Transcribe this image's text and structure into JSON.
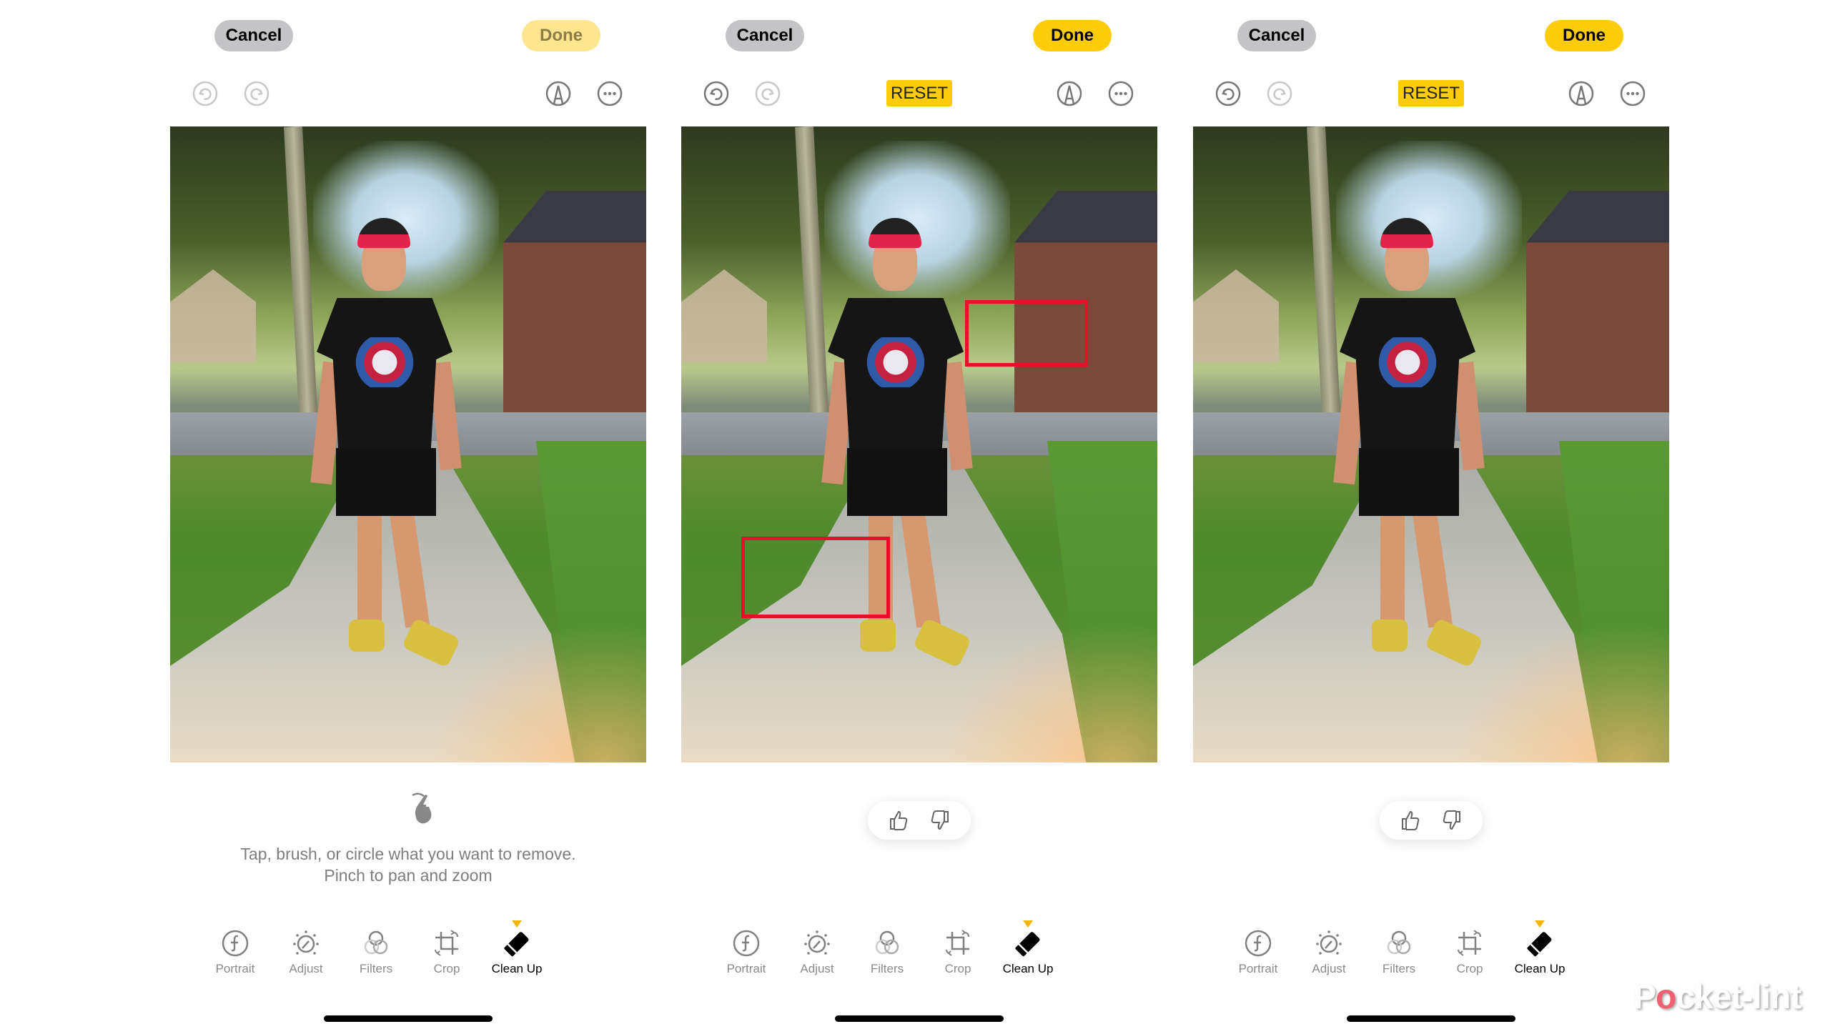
{
  "panels": [
    {
      "cancel_label": "Cancel",
      "done_label": "Done",
      "done_enabled": false,
      "reset_label": null,
      "show_feedback": false,
      "show_boxes": false,
      "hint_line1": "Tap, brush, or circle what you want to remove.",
      "hint_line2": "Pinch to pan and zoom"
    },
    {
      "cancel_label": "Cancel",
      "done_label": "Done",
      "done_enabled": true,
      "reset_label": "RESET",
      "show_feedback": true,
      "show_boxes": true
    },
    {
      "cancel_label": "Cancel",
      "done_label": "Done",
      "done_enabled": true,
      "reset_label": "RESET",
      "show_feedback": true,
      "show_boxes": false
    }
  ],
  "tools": [
    {
      "label": "Portrait",
      "icon": "portrait-f-icon"
    },
    {
      "label": "Adjust",
      "icon": "adjust-dial-icon"
    },
    {
      "label": "Filters",
      "icon": "filters-circles-icon"
    },
    {
      "label": "Crop",
      "icon": "crop-rotate-icon"
    },
    {
      "label": "Clean Up",
      "icon": "eraser-icon",
      "active": true
    }
  ],
  "colors": {
    "accent": "#fecc0a",
    "indicator": "#f5b400",
    "highlight_box": "#e3122b",
    "inactive": "#8a8a8d"
  },
  "watermark": "Pocket-lint"
}
